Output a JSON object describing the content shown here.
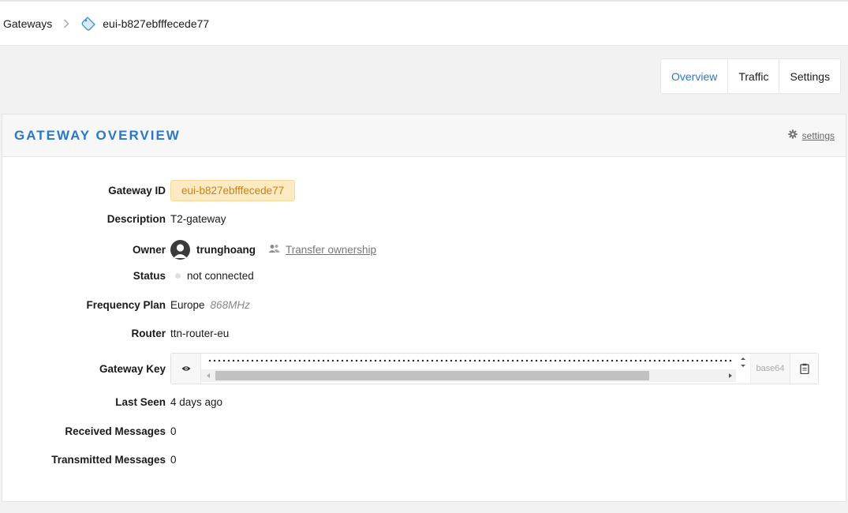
{
  "breadcrumb": {
    "parent": "Gateways",
    "current": "eui-b827ebfffecede77",
    "separator_icon": "chevron-right-icon",
    "current_icon": "gateway-tag-icon"
  },
  "tabs": [
    {
      "label": "Overview",
      "active": true
    },
    {
      "label": "Traffic",
      "active": false
    },
    {
      "label": "Settings",
      "active": false
    }
  ],
  "card": {
    "title": "GATEWAY OVERVIEW",
    "settings_link": "settings",
    "settings_icon": "gear-icon"
  },
  "fields": {
    "gateway_id_label": "Gateway ID",
    "gateway_id": "eui-b827ebfffecede77",
    "description_label": "Description",
    "description": "T2-gateway",
    "owner_label": "Owner",
    "owner": "trunghoang",
    "transfer_ownership": "Transfer ownership",
    "status_label": "Status",
    "status": "not connected",
    "frequency_plan_label": "Frequency Plan",
    "frequency_plan": "Europe",
    "frequency_plan_detail": "868MHz",
    "router_label": "Router",
    "router": "ttn-router-eu",
    "gateway_key_label": "Gateway Key",
    "gateway_key_format": "base64",
    "last_seen_label": "Last Seen",
    "last_seen": "4 days ago",
    "received_label": "Received Messages",
    "received": "0",
    "transmitted_label": "Transmitted Messages",
    "transmitted": "0"
  },
  "colors": {
    "accent": "#2a78c7",
    "id_badge_bg": "#fde9c2",
    "id_badge_text": "#c98312",
    "status_dot": "#e0e0e0"
  }
}
